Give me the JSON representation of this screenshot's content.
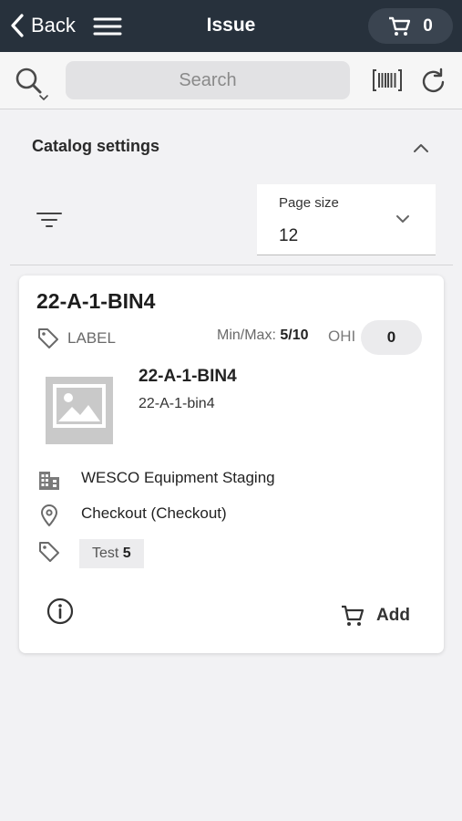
{
  "header": {
    "back_label": "Back",
    "title": "Issue",
    "cart_count": "0",
    "back_icon": "chevron-left-icon",
    "menu_icon": "hamburger-menu-icon",
    "cart_icon": "cart-icon"
  },
  "search": {
    "placeholder": "Search",
    "value": "",
    "search_icon": "search-icon",
    "barcode_icon": "barcode-icon",
    "refresh_icon": "refresh-icon"
  },
  "catalog_settings": {
    "title": "Catalog settings",
    "collapse_icon": "chevron-up-icon",
    "filter_icon": "filter-icon",
    "page_size_label": "Page size",
    "page_size_value": "12"
  },
  "item": {
    "title": "22-A-1-BIN4",
    "label_text": "LABEL",
    "minmax_label": "Min/Max:",
    "minmax_value": "5/10",
    "ohi_label": "OHI",
    "ohi_value": "0",
    "name": "22-A-1-BIN4",
    "subtitle": "22-A-1-bin4",
    "location": "WESCO Equipment Staging",
    "checkout": "Checkout (Checkout)",
    "tag_name": "Test",
    "tag_count": "5",
    "add_label": "Add"
  },
  "colors": {
    "header_bg": "#27313c",
    "cart_pill_bg": "#3a4450",
    "page_bg": "#f2f2f4",
    "card_bg": "#ffffff",
    "chip_bg": "#ececee"
  }
}
